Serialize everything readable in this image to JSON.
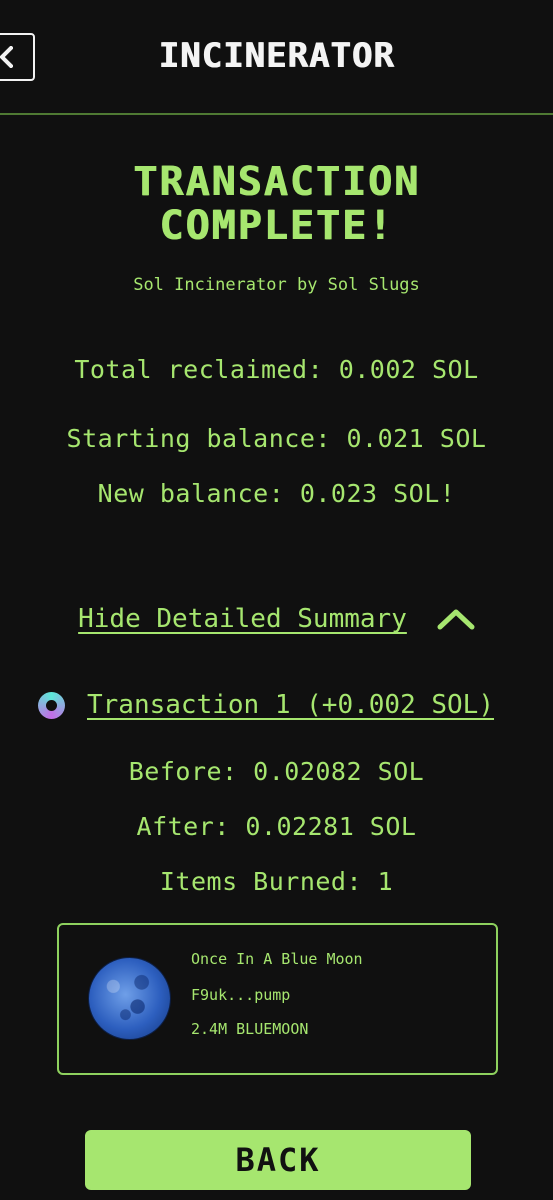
{
  "header": {
    "title": "INCINERATOR",
    "back_icon": "chevron-left-icon"
  },
  "status": {
    "title_line1": "TRANSACTION",
    "title_line2": "COMPLETE!",
    "subtitle": "Sol Incinerator by Sol Slugs"
  },
  "summary": {
    "total_reclaimed": "Total reclaimed: 0.002 SOL",
    "starting_balance": "Starting balance: 0.021 SOL",
    "new_balance": "New balance: 0.023 SOL!"
  },
  "details_toggle": {
    "label": "Hide Detailed Summary",
    "icon": "chevron-up-icon"
  },
  "transaction": {
    "icon": "solana-explorer-icon",
    "label": "Transaction 1 (+0.002 SOL)",
    "before": "Before: 0.02082 SOL",
    "after": "After: 0.02281 SOL",
    "items_burned": "Items Burned: 1"
  },
  "token": {
    "image": "blue-moon-token-image",
    "name": "Once In A Blue Moon",
    "address": "F9uk...pump",
    "amount": "2.4M BLUEMOON"
  },
  "footer": {
    "back_label": "BACK"
  },
  "colors": {
    "background": "#101010",
    "accent": "#a6e66f",
    "header_text": "#f4f4f4"
  }
}
